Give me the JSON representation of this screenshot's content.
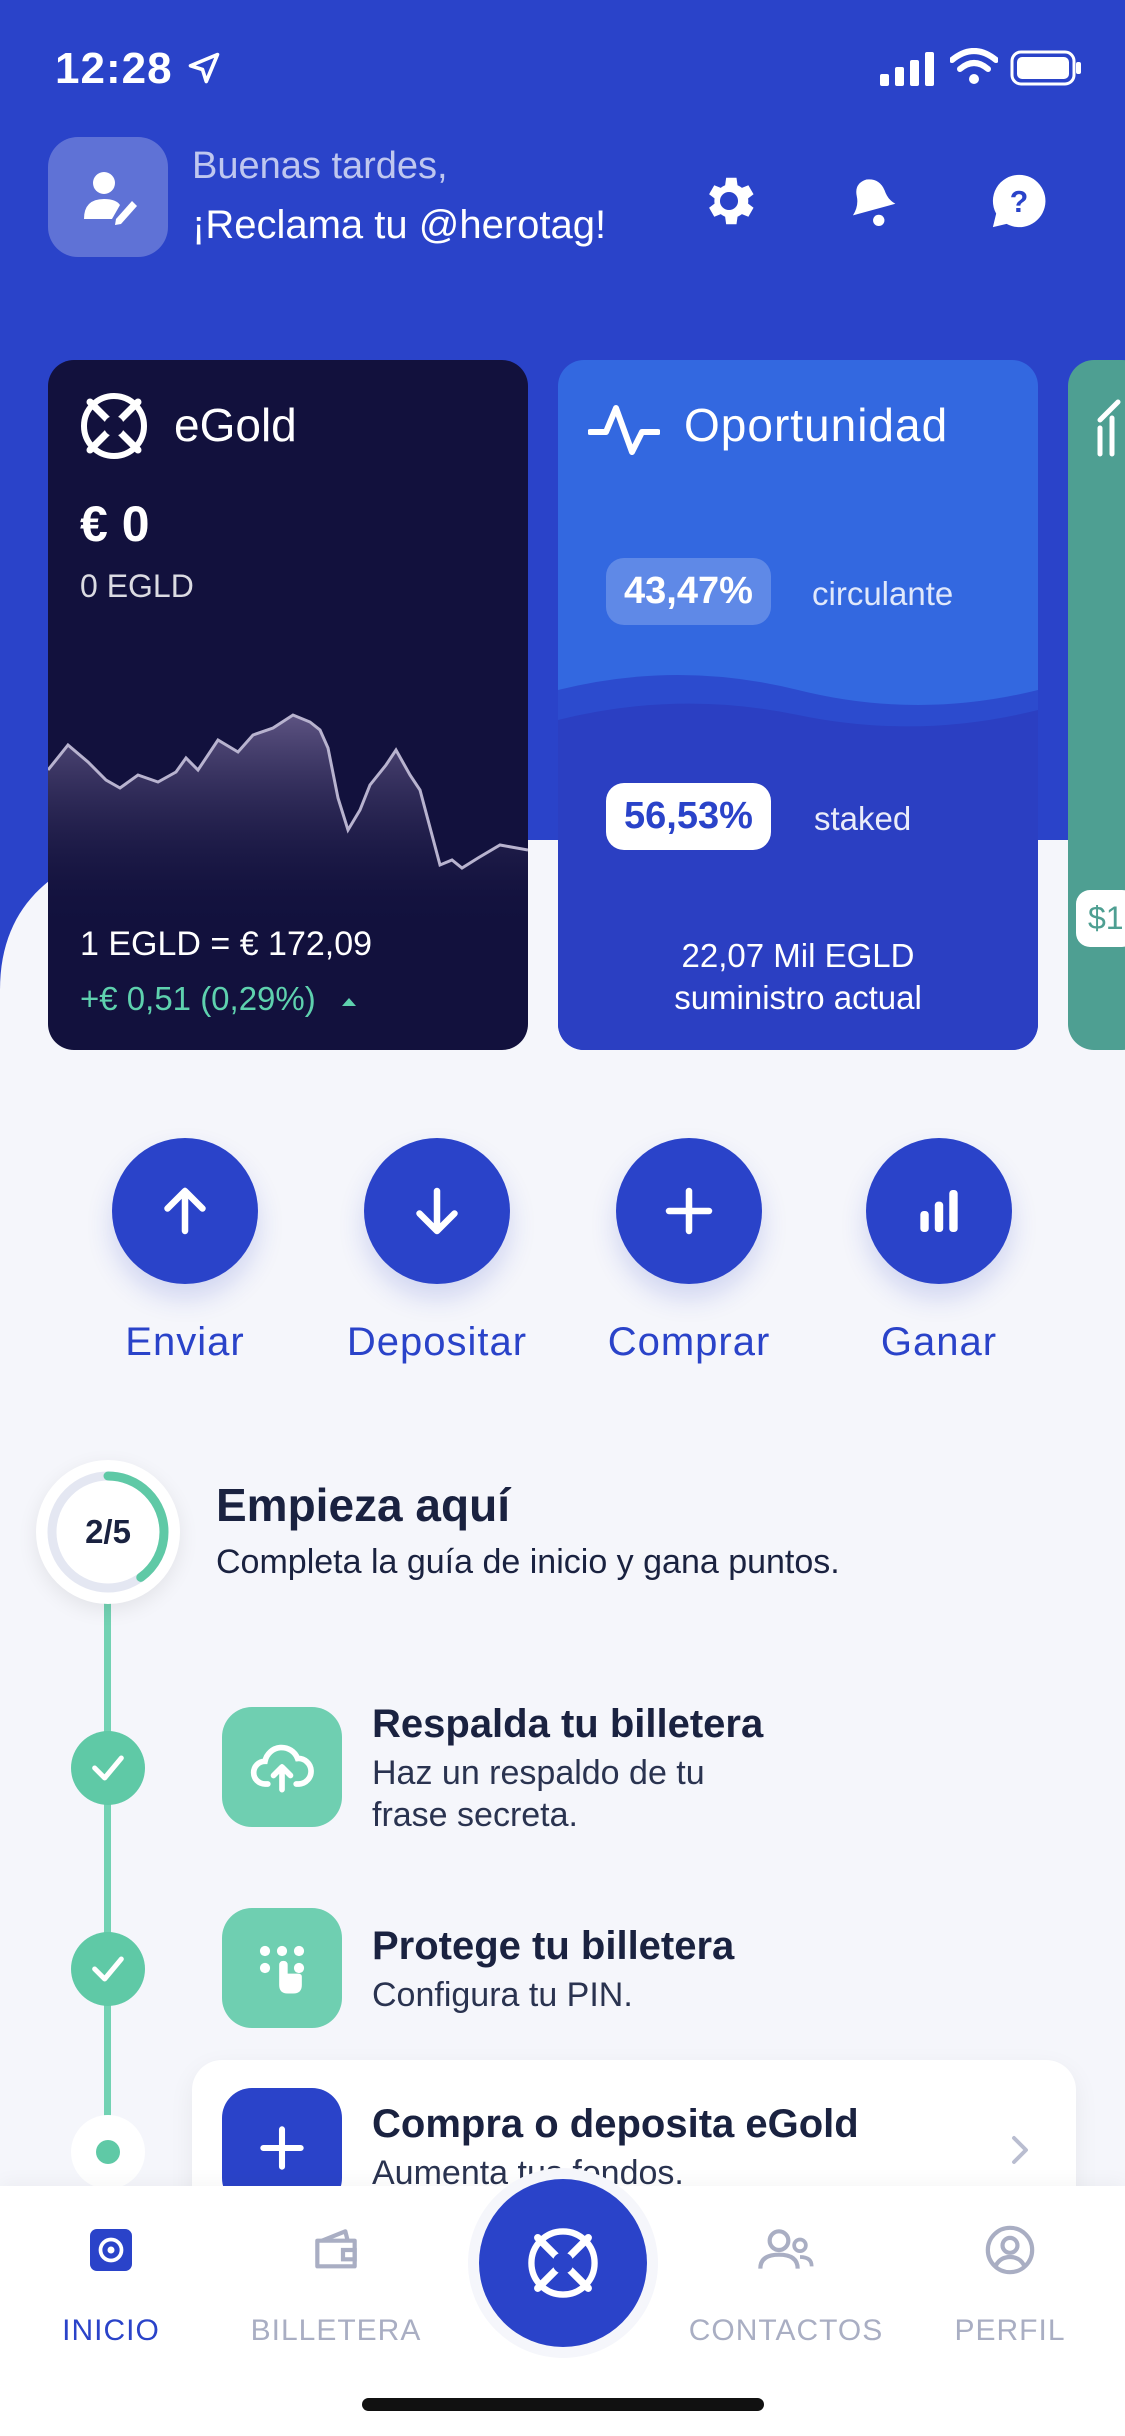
{
  "status_bar": {
    "time": "12:28"
  },
  "header": {
    "greeting": "Buenas tardes,",
    "claim": "¡Reclama tu @herotag!"
  },
  "cards": {
    "egold": {
      "title": "eGold",
      "balance_fiat": "€ 0",
      "balance_token": "0 EGLD",
      "price": "1 EGLD = € 172,09",
      "change": "+€ 0,51 (0,29%)"
    },
    "opportunity": {
      "title": "Oportunidad",
      "circulating_pct": "43,47%",
      "circulating_label": "circulante",
      "staked_pct": "56,53%",
      "staked_label": "staked",
      "supply_value": "22,07 Mil EGLD",
      "supply_label": "suministro actual"
    },
    "peek": {
      "label": "$1"
    }
  },
  "actions": [
    {
      "label": "Enviar",
      "icon": "arrow-up-icon"
    },
    {
      "label": "Depositar",
      "icon": "arrow-down-icon"
    },
    {
      "label": "Comprar",
      "icon": "plus-icon"
    },
    {
      "label": "Ganar",
      "icon": "bar-chart-icon"
    }
  ],
  "guide": {
    "progress": "2/5",
    "progress_fraction": 0.4,
    "title": "Empieza aquí",
    "subtitle": "Completa la guía de inicio y gana puntos.",
    "steps": [
      {
        "title": "Respalda tu billetera",
        "desc_line1": "Haz un respaldo de tu",
        "desc_line2": "frase secreta.",
        "done": true
      },
      {
        "title": "Protege tu billetera",
        "desc_line1": "Configura tu PIN.",
        "done": true
      },
      {
        "title": "Compra o deposita eGold",
        "desc_line1": "Aumenta tus fondos.",
        "done": false
      }
    ]
  },
  "tabbar": {
    "items": [
      {
        "label": "INICIO",
        "active": true
      },
      {
        "label": "BILLETERA",
        "active": false
      },
      {
        "label": "CONTACTOS",
        "active": false
      },
      {
        "label": "PERFIL",
        "active": false
      }
    ]
  },
  "colors": {
    "primary": "#2a43c9",
    "card_dark": "#12113d",
    "accent_green": "#5fc9a6",
    "text_dark": "#1a2240"
  }
}
